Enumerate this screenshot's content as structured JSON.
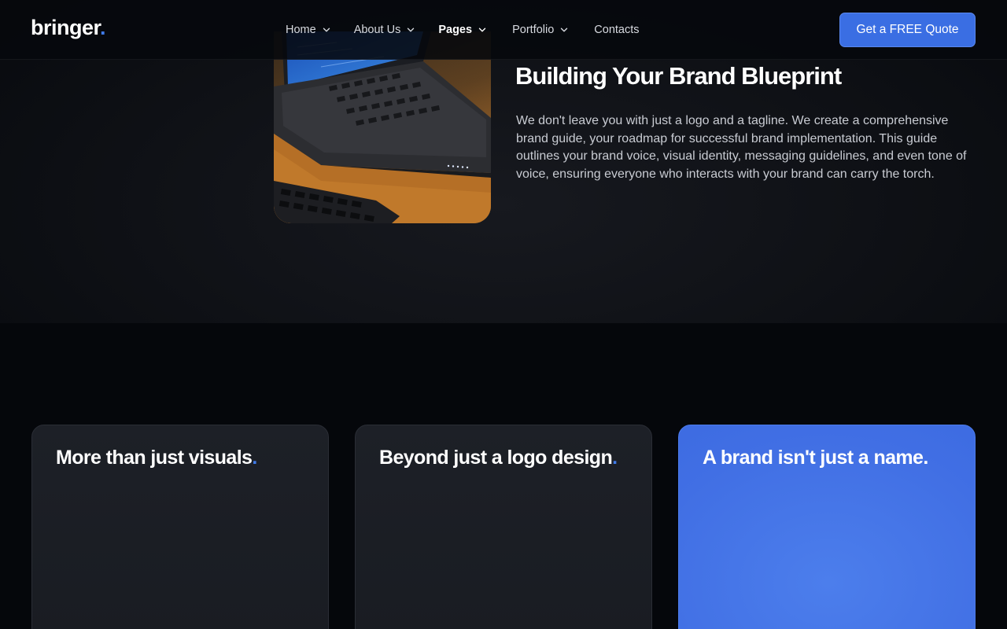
{
  "brand": {
    "name": "bringer",
    "dot": ".",
    "accent_color": "#3f7ae8"
  },
  "nav": {
    "items": [
      {
        "label": "Home",
        "has_dropdown": true
      },
      {
        "label": "About Us",
        "has_dropdown": true
      },
      {
        "label": "Pages",
        "has_dropdown": true,
        "active": true
      },
      {
        "label": "Portfolio",
        "has_dropdown": true
      },
      {
        "label": "Contacts",
        "has_dropdown": false
      }
    ]
  },
  "cta": {
    "label": "Get a FREE Quote",
    "color": "#3a6ee3"
  },
  "feature": {
    "title": "Building Your Brand Blueprint",
    "text": "We don't leave you with just a logo and a tagline. We create a comprehensive brand guide, your roadmap for successful brand implementation. This guide outlines your brand voice, visual identity, messaging guidelines, and even tone of voice, ensuring everyone who interacts with your brand can carry the torch."
  },
  "cards": [
    {
      "title": "More than just visuals",
      "accent": "."
    },
    {
      "title": "Beyond just a logo design",
      "accent": "."
    },
    {
      "title": "A brand isn't just a name.",
      "accent": ""
    }
  ]
}
